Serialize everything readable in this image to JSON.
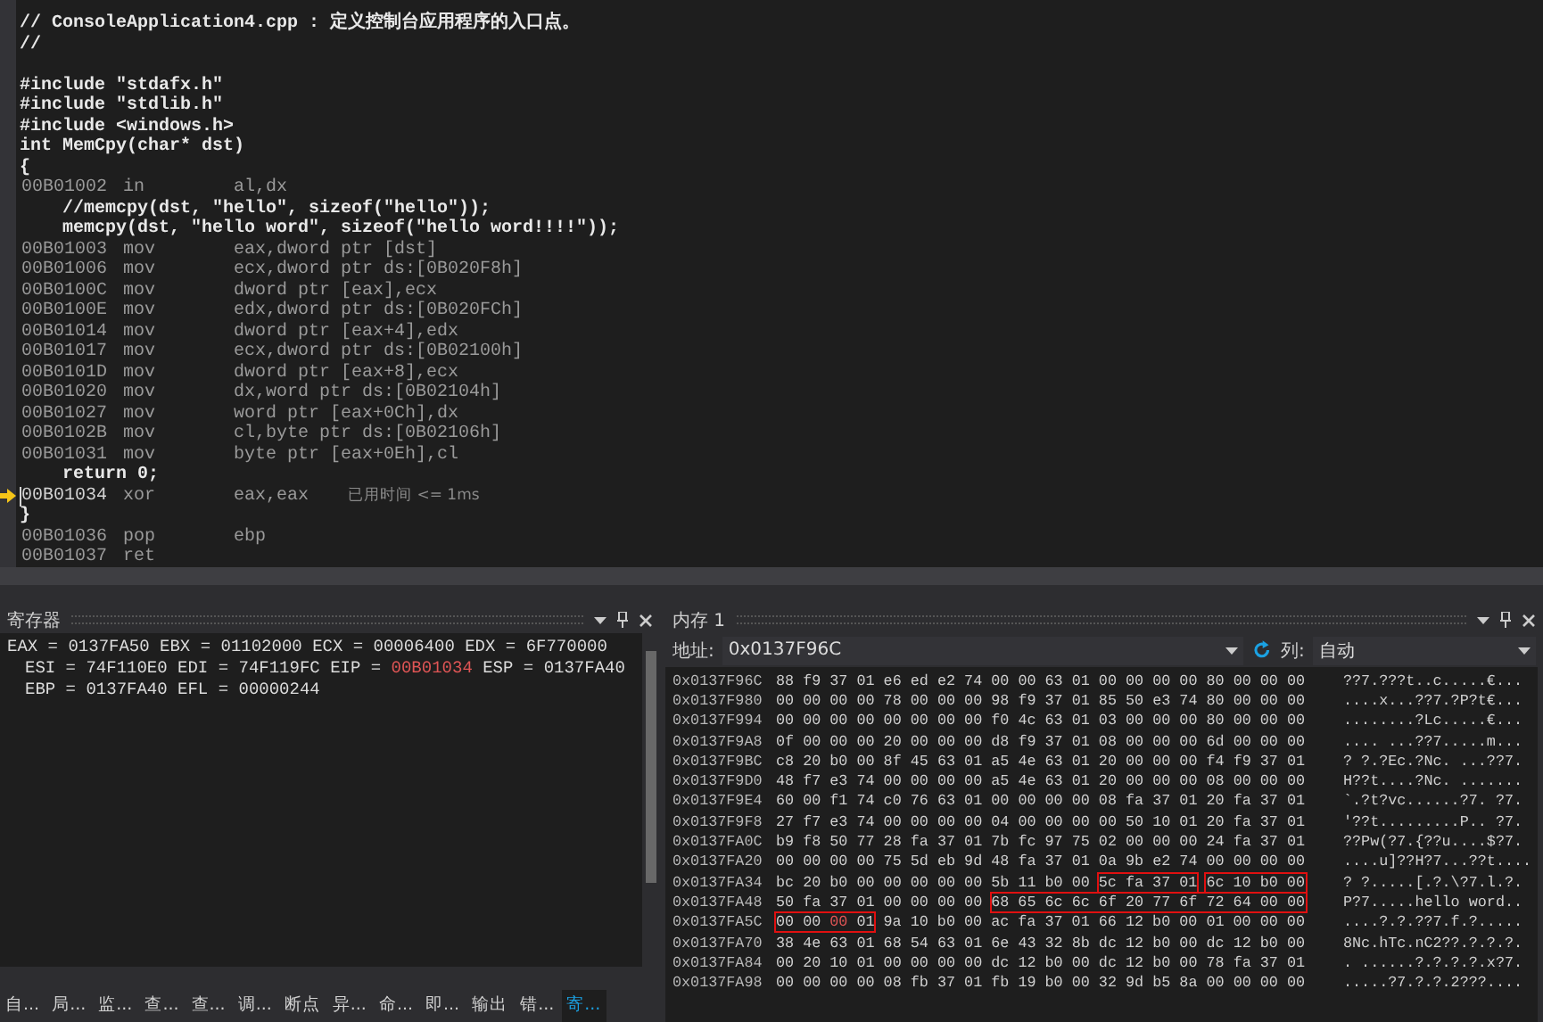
{
  "editor": {
    "lines": [
      {
        "kind": "source",
        "text": "// ConsoleApplication4.cpp : 定义控制台应用程序的入口点。"
      },
      {
        "kind": "source",
        "text": "//"
      },
      {
        "kind": "blank"
      },
      {
        "kind": "source",
        "text": "#include \"stdafx.h\""
      },
      {
        "kind": "source",
        "text": "#include \"stdlib.h\""
      },
      {
        "kind": "source",
        "text": "#include <windows.h>"
      },
      {
        "kind": "source",
        "text": "int MemCpy(char* dst)"
      },
      {
        "kind": "source",
        "text": "{"
      },
      {
        "kind": "asm",
        "address": "00B01002",
        "op": "in",
        "operand": "al,dx",
        "current": false
      },
      {
        "kind": "source",
        "text": "    //memcpy(dst, \"hello\", sizeof(\"hello\"));"
      },
      {
        "kind": "source",
        "text": "    memcpy(dst, \"hello word\", sizeof(\"hello word!!!!\"));"
      },
      {
        "kind": "asm",
        "address": "00B01003",
        "op": "mov",
        "operand": "eax,dword ptr [dst]",
        "current": false
      },
      {
        "kind": "asm",
        "address": "00B01006",
        "op": "mov",
        "operand": "ecx,dword ptr ds:[0B020F8h]",
        "current": false
      },
      {
        "kind": "asm",
        "address": "00B0100C",
        "op": "mov",
        "operand": "dword ptr [eax],ecx",
        "current": false
      },
      {
        "kind": "asm",
        "address": "00B0100E",
        "op": "mov",
        "operand": "edx,dword ptr ds:[0B020FCh]",
        "current": false
      },
      {
        "kind": "asm",
        "address": "00B01014",
        "op": "mov",
        "operand": "dword ptr [eax+4],edx",
        "current": false
      },
      {
        "kind": "asm",
        "address": "00B01017",
        "op": "mov",
        "operand": "ecx,dword ptr ds:[0B02100h]",
        "current": false
      },
      {
        "kind": "asm",
        "address": "00B0101D",
        "op": "mov",
        "operand": "dword ptr [eax+8],ecx",
        "current": false
      },
      {
        "kind": "asm",
        "address": "00B01020",
        "op": "mov",
        "operand": "dx,word ptr ds:[0B02104h]",
        "current": false
      },
      {
        "kind": "asm",
        "address": "00B01027",
        "op": "mov",
        "operand": "word ptr [eax+0Ch],dx",
        "current": false
      },
      {
        "kind": "asm",
        "address": "00B0102B",
        "op": "mov",
        "operand": "cl,byte ptr ds:[0B02106h]",
        "current": false
      },
      {
        "kind": "asm",
        "address": "00B01031",
        "op": "mov",
        "operand": "byte ptr [eax+0Eh],cl",
        "current": false
      },
      {
        "kind": "source",
        "text": "    return 0;"
      },
      {
        "kind": "asm",
        "address": "00B01034",
        "op": "xor",
        "operand": "eax,eax",
        "current": true,
        "note": "已用时间 <= 1ms"
      },
      {
        "kind": "source",
        "text": "}"
      },
      {
        "kind": "asm",
        "address": "00B01036",
        "op": "pop",
        "operand": "ebp",
        "current": false
      },
      {
        "kind": "asm",
        "address": "00B01037",
        "op": "ret",
        "current": false
      }
    ]
  },
  "registers": {
    "title": "寄存器",
    "lines": [
      [
        {
          "name": "EAX =",
          "value": "0137FA50",
          "changed": false
        },
        {
          "name": "EBX =",
          "value": "01102000",
          "changed": false
        },
        {
          "name": "ECX =",
          "value": "00006400",
          "changed": false
        },
        {
          "name": "EDX =",
          "value": "6F770000",
          "changed": false
        }
      ],
      [
        {
          "name": "ESI =",
          "value": "74F110E0",
          "changed": false
        },
        {
          "name": "EDI =",
          "value": "74F119FC",
          "changed": false
        },
        {
          "name": "EIP =",
          "value": "00B01034",
          "changed": true
        },
        {
          "name": "ESP =",
          "value": "0137FA40",
          "changed": false
        }
      ],
      [
        {
          "name": "EBP =",
          "value": "0137FA40",
          "changed": false
        },
        {
          "name": "EFL =",
          "value": "00000244",
          "changed": false
        }
      ]
    ]
  },
  "bottom_tabs": [
    {
      "label": "自...",
      "selected": false
    },
    {
      "label": "局...",
      "selected": false
    },
    {
      "label": "监...",
      "selected": false
    },
    {
      "label": "查...",
      "selected": false
    },
    {
      "label": "查...",
      "selected": false
    },
    {
      "label": "调...",
      "selected": false
    },
    {
      "label": "断点",
      "selected": false
    },
    {
      "label": "异...",
      "selected": false
    },
    {
      "label": "命...",
      "selected": false
    },
    {
      "label": "即...",
      "selected": false
    },
    {
      "label": "输出",
      "selected": false
    },
    {
      "label": "错...",
      "selected": false
    },
    {
      "label": "寄...",
      "selected": true
    }
  ],
  "memory": {
    "title": "内存 1",
    "address_label": "地址:",
    "address": "0x0137F96C",
    "columns_label": "列:",
    "columns": "自动",
    "rows": [
      {
        "address": "0x0137F96C",
        "groups": [
          {
            "boxed": false,
            "parts": [
              {
                "text": "88 f9 37 01 e6 ed e2 74 00 00 63 01 00 00 00 00 80 00 00 00",
                "changed": false
              }
            ]
          }
        ],
        "ascii": "??7.???t..c.....€..."
      },
      {
        "address": "0x0137F980",
        "groups": [
          {
            "boxed": false,
            "parts": [
              {
                "text": "00 00 00 00 78 00 00 00 98 f9 37 01 85 50 e3 74 80 00 00 00",
                "changed": false
              }
            ]
          }
        ],
        "ascii": "....x...??7.?P?t€..."
      },
      {
        "address": "0x0137F994",
        "groups": [
          {
            "boxed": false,
            "parts": [
              {
                "text": "00 00 00 00 00 00 00 00 f0 4c 63 01 03 00 00 00 80 00 00 00",
                "changed": false
              }
            ]
          }
        ],
        "ascii": "........?Lc.....€..."
      },
      {
        "address": "0x0137F9A8",
        "groups": [
          {
            "boxed": false,
            "parts": [
              {
                "text": "0f 00 00 00 20 00 00 00 d8 f9 37 01 08 00 00 00 6d 00 00 00",
                "changed": false
              }
            ]
          }
        ],
        "ascii": ".... ...??7.....m..."
      },
      {
        "address": "0x0137F9BC",
        "groups": [
          {
            "boxed": false,
            "parts": [
              {
                "text": "c8 20 b0 00 8f 45 63 01 a5 4e 63 01 20 00 00 00 f4 f9 37 01",
                "changed": false
              }
            ]
          }
        ],
        "ascii": "? ?.?Ec.?Nc. ...??7."
      },
      {
        "address": "0x0137F9D0",
        "groups": [
          {
            "boxed": false,
            "parts": [
              {
                "text": "48 f7 e3 74 00 00 00 00 a5 4e 63 01 20 00 00 00 08 00 00 00",
                "changed": false
              }
            ]
          }
        ],
        "ascii": "H??t....?Nc. ......."
      },
      {
        "address": "0x0137F9E4",
        "groups": [
          {
            "boxed": false,
            "parts": [
              {
                "text": "60 00 f1 74 c0 76 63 01 00 00 00 00 08 fa 37 01 20 fa 37 01",
                "changed": false
              }
            ]
          }
        ],
        "ascii": "`.?t?vc......?7. ?7."
      },
      {
        "address": "0x0137F9F8",
        "groups": [
          {
            "boxed": false,
            "parts": [
              {
                "text": "27 f7 e3 74 00 00 00 00 04 00 00 00 00 50 10 01 20 fa 37 01",
                "changed": false
              }
            ]
          }
        ],
        "ascii": "'??t.........P.. ?7."
      },
      {
        "address": "0x0137FA0C",
        "groups": [
          {
            "boxed": false,
            "parts": [
              {
                "text": "b9 f8 50 77 28 fa 37 01 7b fc 97 75 02 00 00 00 24 fa 37 01",
                "changed": false
              }
            ]
          }
        ],
        "ascii": "??Pw(?7.{??u....$?7."
      },
      {
        "address": "0x0137FA20",
        "groups": [
          {
            "boxed": false,
            "parts": [
              {
                "text": "00 00 00 00 75 5d eb 9d 48 fa 37 01 0a 9b e2 74 00 00 00 00",
                "changed": false
              }
            ]
          }
        ],
        "ascii": "....u]??H?7...??t...."
      },
      {
        "address": "0x0137FA34",
        "groups": [
          {
            "boxed": false,
            "parts": [
              {
                "text": "bc 20 b0 00 00 00 00 00 5b 11 b0 00",
                "changed": false
              }
            ]
          },
          {
            "boxed": true,
            "parts": [
              {
                "text": "5c fa 37 01",
                "changed": false
              }
            ]
          },
          {
            "boxed": true,
            "parts": [
              {
                "text": "6c 10 b0 00",
                "changed": false
              }
            ]
          }
        ],
        "ascii": "? ?.....[.?.\\?7.l.?."
      },
      {
        "address": "0x0137FA48",
        "groups": [
          {
            "boxed": false,
            "parts": [
              {
                "text": "50 fa 37 01 00 00 00 00",
                "changed": false
              }
            ]
          },
          {
            "boxed": true,
            "parts": [
              {
                "text": "68 65 6c 6c 6f 20 77 6f 72 64 00 00",
                "changed": false
              }
            ]
          }
        ],
        "ascii": "P?7.....hello word.."
      },
      {
        "address": "0x0137FA5C",
        "groups": [
          {
            "boxed": true,
            "parts": [
              {
                "text": "00 00",
                "changed": false
              },
              {
                "text": "00",
                "changed": true
              },
              {
                "text": "01",
                "changed": false
              }
            ]
          },
          {
            "boxed": false,
            "parts": [
              {
                "text": "9a 10 b0 00 ac fa 37 01 66 12 b0 00 01 00 00 00",
                "changed": false
              }
            ]
          }
        ],
        "ascii": "....?.?.??7.f.?....."
      },
      {
        "address": "0x0137FA70",
        "groups": [
          {
            "boxed": false,
            "parts": [
              {
                "text": "38 4e 63 01 68 54 63 01 6e 43 32 8b dc 12 b0 00 dc 12 b0 00",
                "changed": false
              }
            ]
          }
        ],
        "ascii": "8Nc.hTc.nC2??.?.?.?."
      },
      {
        "address": "0x0137FA84",
        "groups": [
          {
            "boxed": false,
            "parts": [
              {
                "text": "00 20 10 01 00 00 00 00 dc 12 b0 00 dc 12 b0 00 78 fa 37 01",
                "changed": false
              }
            ]
          }
        ],
        "ascii": ". ......?.?.?.?.x?7."
      },
      {
        "address": "0x0137FA98",
        "groups": [
          {
            "boxed": false,
            "parts": [
              {
                "text": "00 00 00 00 08 fb 37 01 fb 19 b0 00 32 9d b5 8a 00 00 00 00",
                "changed": false
              }
            ]
          }
        ],
        "ascii": ".....?7.?.?.2???...."
      }
    ]
  }
}
